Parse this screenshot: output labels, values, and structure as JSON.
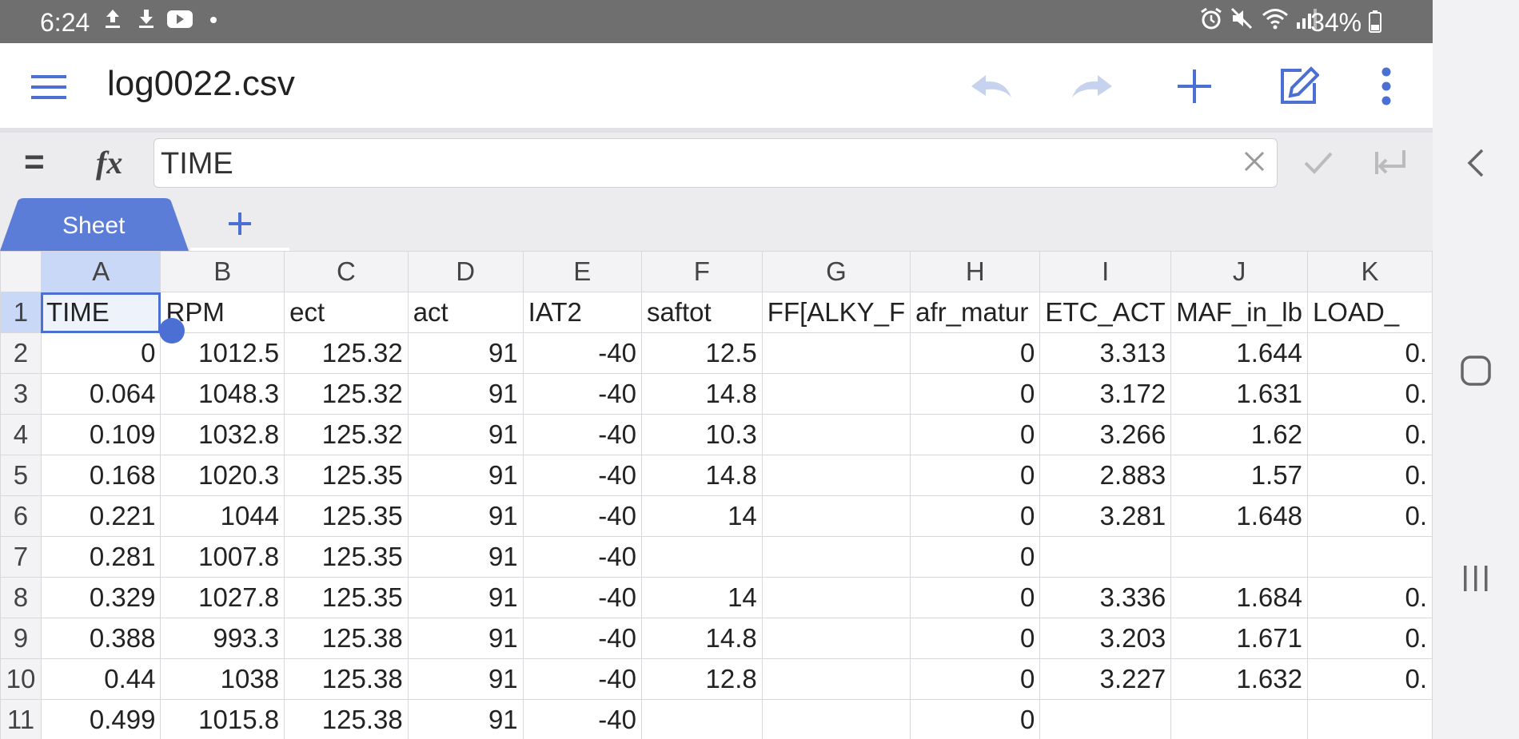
{
  "status": {
    "time": "6:24",
    "battery": "34%",
    "icons": [
      "upload-icon",
      "download-icon",
      "youtube-icon",
      "dot-icon",
      "alarm-icon",
      "mute-icon",
      "wifi-icon",
      "signal-icon",
      "battery-icon"
    ]
  },
  "toolbar": {
    "title": "log0022.csv",
    "icons": [
      "menu-icon",
      "undo-icon",
      "redo-icon",
      "add-icon",
      "edit-icon",
      "more-icon"
    ]
  },
  "formula": {
    "equals_label": "=",
    "fx_label": "fx",
    "value": "TIME"
  },
  "tabs": {
    "sheet_label": "Sheet",
    "add_label": "+"
  },
  "grid": {
    "columns": [
      "A",
      "B",
      "C",
      "D",
      "E",
      "F",
      "G",
      "H",
      "I",
      "J",
      "K"
    ],
    "rows": [
      {
        "n": "1",
        "cells": [
          "TIME",
          "RPM",
          "ect",
          "act",
          "IAT2",
          "saftot",
          "FF[ALKY_F",
          "afr_matur",
          "ETC_ACT",
          "MAF_in_lb",
          "LOAD_"
        ]
      },
      {
        "n": "2",
        "cells": [
          "0",
          "1012.5",
          "125.32",
          "91",
          "-40",
          "12.5",
          "",
          "0",
          "3.313",
          "1.644",
          "0."
        ]
      },
      {
        "n": "3",
        "cells": [
          "0.064",
          "1048.3",
          "125.32",
          "91",
          "-40",
          "14.8",
          "",
          "0",
          "3.172",
          "1.631",
          "0."
        ]
      },
      {
        "n": "4",
        "cells": [
          "0.109",
          "1032.8",
          "125.32",
          "91",
          "-40",
          "10.3",
          "",
          "0",
          "3.266",
          "1.62",
          "0."
        ]
      },
      {
        "n": "5",
        "cells": [
          "0.168",
          "1020.3",
          "125.35",
          "91",
          "-40",
          "14.8",
          "",
          "0",
          "2.883",
          "1.57",
          "0."
        ]
      },
      {
        "n": "6",
        "cells": [
          "0.221",
          "1044",
          "125.35",
          "91",
          "-40",
          "14",
          "",
          "0",
          "3.281",
          "1.648",
          "0."
        ]
      },
      {
        "n": "7",
        "cells": [
          "0.281",
          "1007.8",
          "125.35",
          "91",
          "-40",
          "",
          "",
          "0",
          "",
          "",
          ""
        ]
      },
      {
        "n": "8",
        "cells": [
          "0.329",
          "1027.8",
          "125.35",
          "91",
          "-40",
          "14",
          "",
          "0",
          "3.336",
          "1.684",
          "0."
        ]
      },
      {
        "n": "9",
        "cells": [
          "0.388",
          "993.3",
          "125.38",
          "91",
          "-40",
          "14.8",
          "",
          "0",
          "3.203",
          "1.671",
          "0."
        ]
      },
      {
        "n": "10",
        "cells": [
          "0.44",
          "1038",
          "125.38",
          "91",
          "-40",
          "12.8",
          "",
          "0",
          "3.227",
          "1.632",
          "0."
        ]
      },
      {
        "n": "11",
        "cells": [
          "0.499",
          "1015.8",
          "125.38",
          "91",
          "-40",
          "",
          "",
          "0",
          "",
          "",
          ""
        ]
      }
    ]
  },
  "colors": {
    "accent": "#4b6fd3",
    "statusbar": "#6f6f6f",
    "selected_header": "#c9d8f7"
  }
}
